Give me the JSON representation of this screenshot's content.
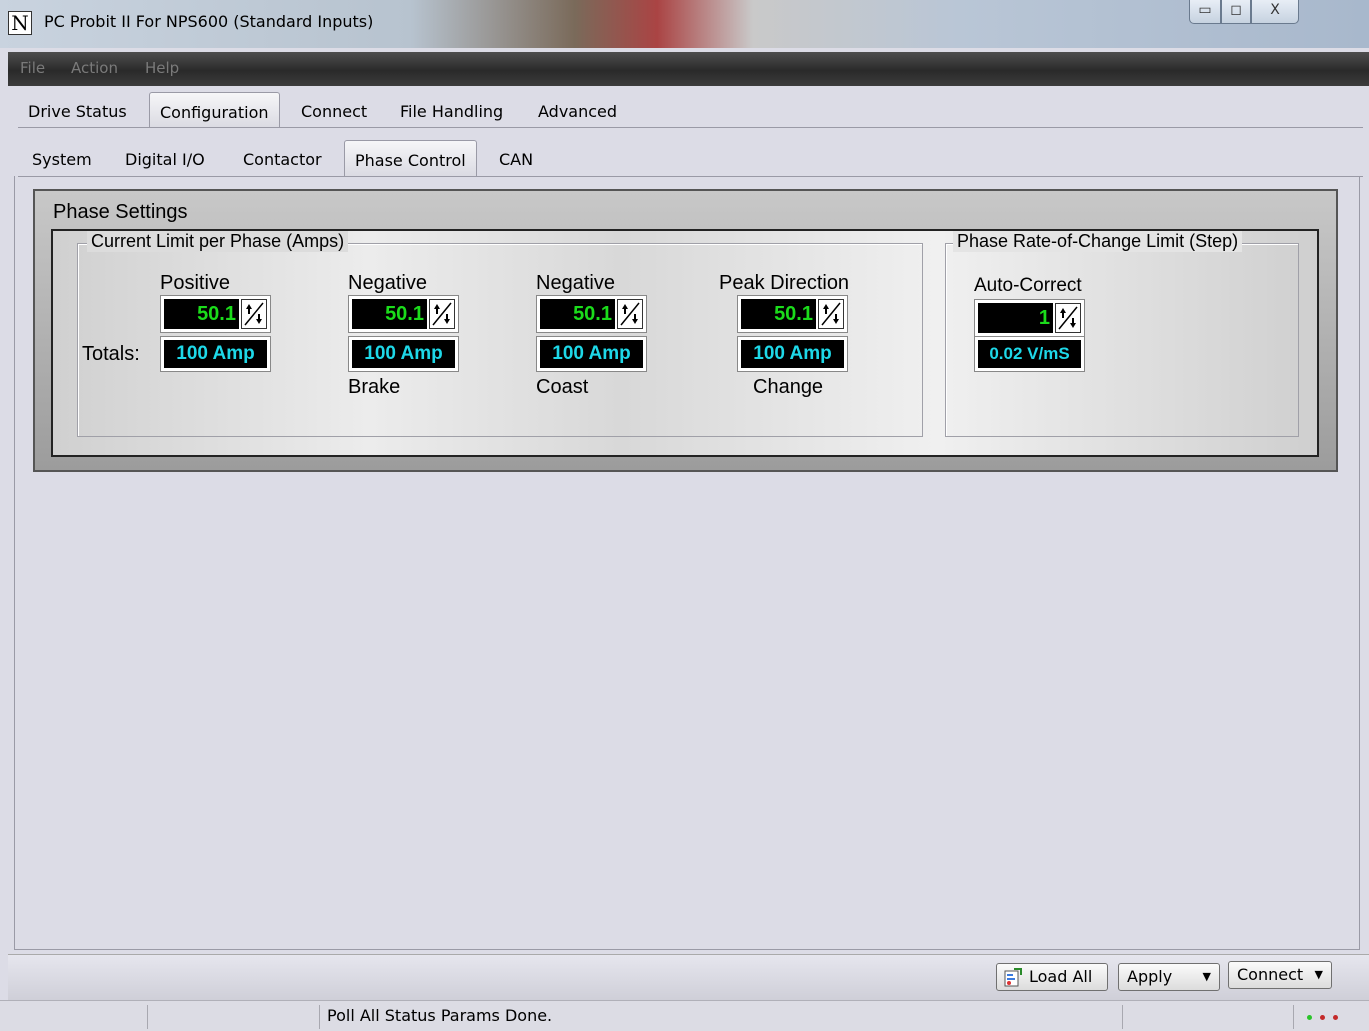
{
  "window": {
    "logo": "N",
    "title": "PC Probit II  For NPS600 (Standard Inputs)",
    "controls": {
      "minimize": "▭",
      "maximize": "◻",
      "close": "X"
    }
  },
  "menu": {
    "file": "File",
    "action": "Action",
    "help": "Help"
  },
  "tabs_main": [
    "Drive Status",
    "Configuration",
    "Connect",
    "File Handling",
    "Advanced"
  ],
  "tabs_main_active": "Configuration",
  "tabs_sub": [
    "System",
    "Digital I/O",
    "Contactor",
    "Phase Control",
    "CAN"
  ],
  "tabs_sub_active": "Phase Control",
  "phase_settings": {
    "title": "Phase Settings",
    "current_limit": {
      "title": "Current Limit per Phase (Amps)",
      "totals_label": "Totals:",
      "columns": [
        {
          "top_label": "Positive",
          "value": "50.1",
          "total": "100 Amp",
          "bottom_label": ""
        },
        {
          "top_label": "Negative",
          "value": "50.1",
          "total": "100 Amp",
          "bottom_label": "Brake"
        },
        {
          "top_label": "Negative",
          "value": "50.1",
          "total": "100 Amp",
          "bottom_label": "Coast"
        },
        {
          "top_label": "Peak Direction",
          "value": "50.1",
          "total": "100 Amp",
          "bottom_label": "Change"
        }
      ]
    },
    "rate_limit": {
      "title": "Phase Rate-of-Change Limit (Step)",
      "label": "Auto-Correct",
      "value": "1",
      "display": "0.02 V/mS"
    }
  },
  "buttons": {
    "load_all": "Load All",
    "apply": "Apply",
    "connect": "Connect"
  },
  "status": {
    "message": "Poll All Status Params Done."
  },
  "colors": {
    "value_green": "#1bdc1b",
    "display_cyan": "#1ed8e8"
  }
}
